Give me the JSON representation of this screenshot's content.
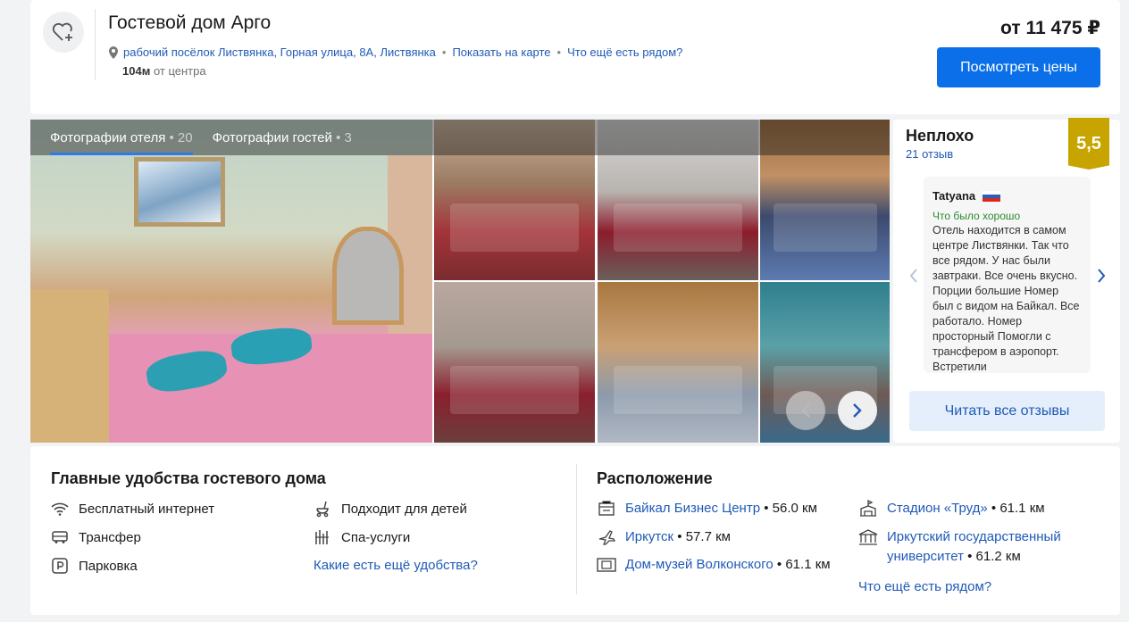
{
  "header": {
    "title": "Гостевой дом Арго",
    "address": "рабочий посёлок Листвянка, Горная улица, 8А, Листвянка",
    "show_on_map": "Показать на карте",
    "whats_nearby": "Что ещё есть рядом?",
    "distance_value": "104м",
    "distance_suffix": "от центра",
    "price": "от 11 475 ₽",
    "view_prices_button": "Посмотреть цены"
  },
  "gallery": {
    "tabs": [
      {
        "label": "Фотографии отеля",
        "count": "20",
        "active": true
      },
      {
        "label": "Фотографии гостей",
        "count": "3",
        "active": false
      }
    ]
  },
  "reviews": {
    "rating_label": "Неплохо",
    "count": "21 отзыв",
    "score": "5,5",
    "reviewer": "Tatyana",
    "good_label": "Что было хорошо",
    "text": "Отель находится в самом центре Листвянки. Так что все рядом. У нас были завтраки. Все очень вкусно. Порции большие Номер был с видом на Байкал. Все работало. Номер просторный Помогли с трансфером в аэропорт. Встретили",
    "read_all": "Читать все отзывы"
  },
  "amenities": {
    "title": "Главные удобства гостевого дома",
    "items": [
      {
        "label": "Бесплатный интернет",
        "icon": "wifi-icon"
      },
      {
        "label": "Подходит для детей",
        "icon": "stroller-icon"
      },
      {
        "label": "Трансфер",
        "icon": "bus-icon"
      },
      {
        "label": "Спа-услуги",
        "icon": "spa-icon"
      },
      {
        "label": "Парковка",
        "icon": "parking-icon"
      }
    ],
    "more": "Какие есть ещё удобства?"
  },
  "location": {
    "title": "Расположение",
    "pois": [
      {
        "name": "Байкал Бизнес Центр",
        "dist": "56.0 км",
        "icon": "business-center-icon"
      },
      {
        "name": "Иркутск",
        "dist": "57.7 км",
        "icon": "airplane-icon"
      },
      {
        "name": "Дом-музей Волконского",
        "dist": "61.1 км",
        "icon": "museum-icon"
      },
      {
        "name": "Стадион «Труд»",
        "dist": "61.1 км",
        "icon": "stadium-icon"
      },
      {
        "name": "Иркутский государственный университет",
        "name_line1": "Иркутский государственный",
        "name_line2": "университет",
        "dist": "61.2 км",
        "icon": "university-icon"
      }
    ],
    "more": "Что ещё есть рядом?"
  },
  "colors": {
    "accent": "#0a6fe8",
    "link": "#1f5ab7",
    "score_bg": "#c8a400",
    "positive": "#2e8b2e"
  }
}
